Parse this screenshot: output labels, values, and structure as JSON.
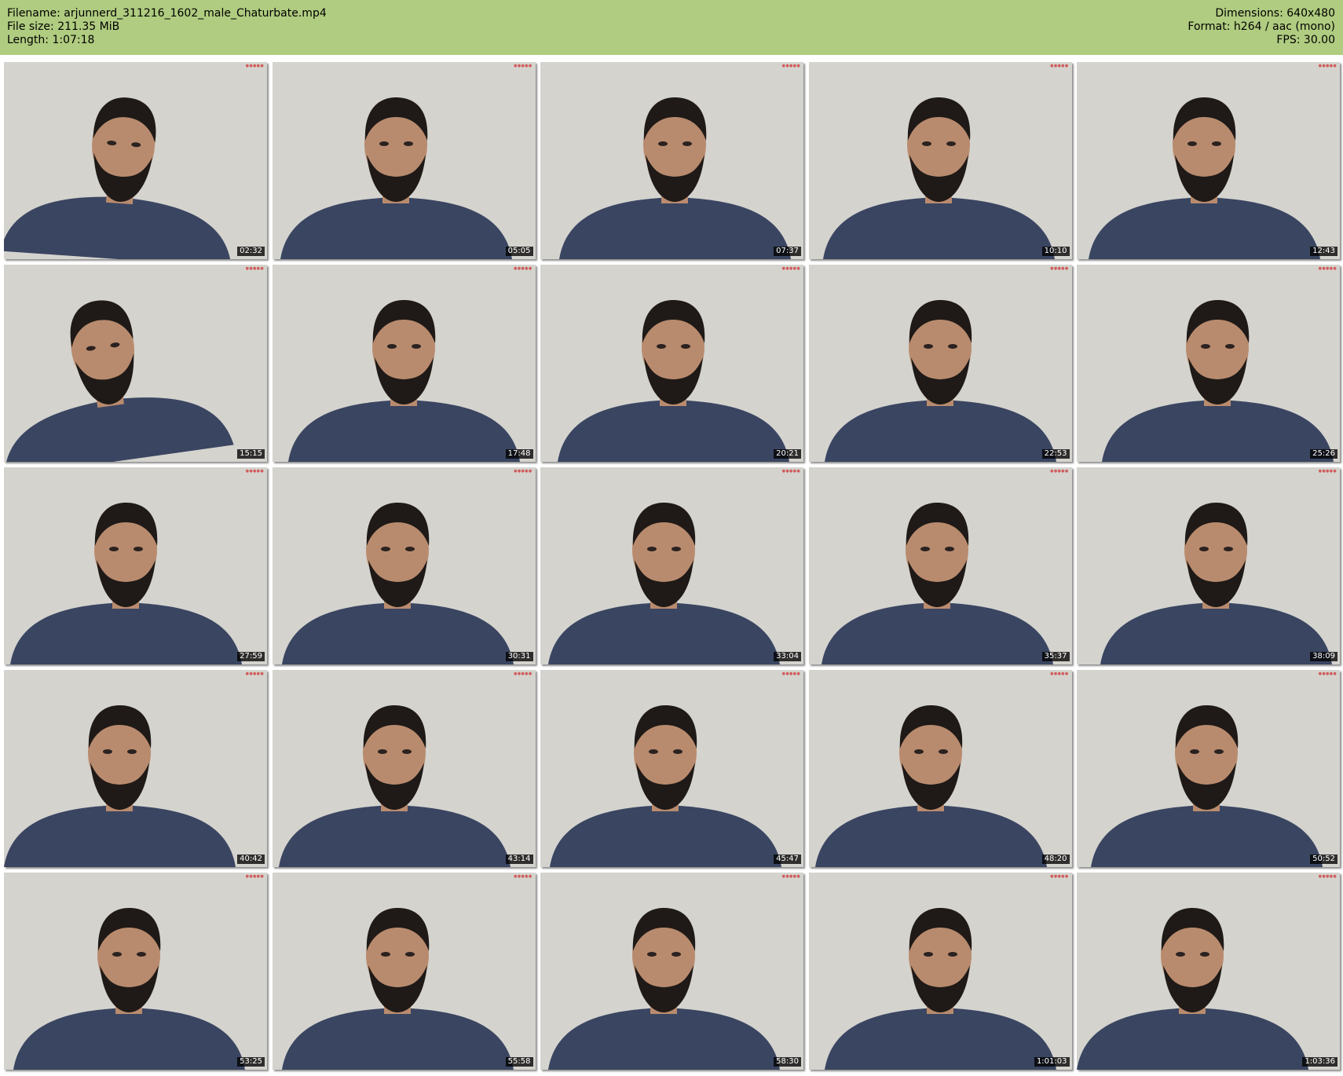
{
  "header": {
    "filename_line": "Filename: arjunnerd_311216_1602_male_Chaturbate.mp4",
    "filesize_line": "File size: 211.35 MiB",
    "length_line": "Length: 1:07:18",
    "dimensions_line": "Dimensions: 640x480",
    "format_line": "Format: h264 / aac (mono)",
    "fps_line": "FPS: 30.00"
  },
  "colors": {
    "header_bg": "#b0cc80",
    "wall": "#d4d3ce",
    "shirt": "#3a4561",
    "skin": "#b98b6e",
    "hair": "#1f1a17"
  },
  "thumbnails": [
    {
      "timestamp": "02:32"
    },
    {
      "timestamp": "05:05"
    },
    {
      "timestamp": "07:37"
    },
    {
      "timestamp": "10:10"
    },
    {
      "timestamp": "12:43"
    },
    {
      "timestamp": "15:15"
    },
    {
      "timestamp": "17:48"
    },
    {
      "timestamp": "20:21"
    },
    {
      "timestamp": "22:53"
    },
    {
      "timestamp": "25:26"
    },
    {
      "timestamp": "27:59"
    },
    {
      "timestamp": "30:31"
    },
    {
      "timestamp": "33:04"
    },
    {
      "timestamp": "35:37"
    },
    {
      "timestamp": "38:09"
    },
    {
      "timestamp": "40:42"
    },
    {
      "timestamp": "43:14"
    },
    {
      "timestamp": "45:47"
    },
    {
      "timestamp": "48:20"
    },
    {
      "timestamp": "50:52"
    },
    {
      "timestamp": "53:25"
    },
    {
      "timestamp": "55:58"
    },
    {
      "timestamp": "58:30"
    },
    {
      "timestamp": "1:01:03"
    },
    {
      "timestamp": "1:03:36"
    }
  ]
}
